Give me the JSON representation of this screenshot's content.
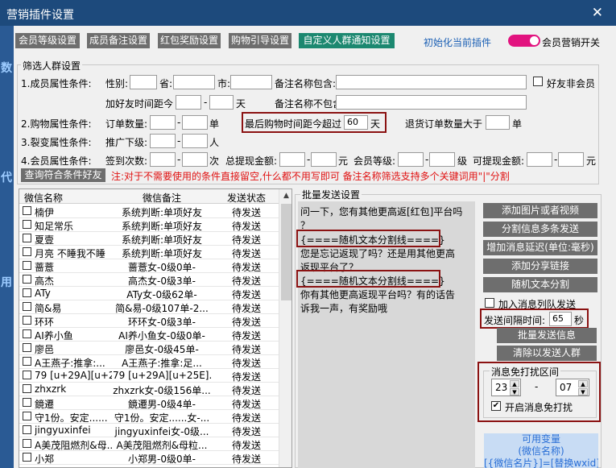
{
  "window": {
    "title": "营销插件设置"
  },
  "tabs": [
    {
      "label": "会员等级设置",
      "active": false
    },
    {
      "label": "成员备注设置",
      "active": false
    },
    {
      "label": "红包奖励设置",
      "active": false
    },
    {
      "label": "购物引导设置",
      "active": false
    },
    {
      "label": "自定义人群通知设置",
      "active": true
    }
  ],
  "header": {
    "init_link": "初始化当前插件",
    "toggle_label": "会员营销开关",
    "toggle_on": true
  },
  "filter": {
    "legend": "筛选人群设置",
    "row1": {
      "label": "1.成员属性条件:",
      "gender": "性别:",
      "province": "省:",
      "city": "市:",
      "remark_contains": "备注名称包含:",
      "friend_non_member": "好友非会员"
    },
    "row1b": {
      "add_days": "加好友时间距今",
      "dash": "-",
      "unit_day": "天",
      "remark_not_contains": "备注名称不包含:"
    },
    "row2": {
      "label": "2.购物属性条件:",
      "order_count": "订单数量:",
      "dash": "-",
      "unit": "单",
      "last_purchase": "最后购物时间距今超过",
      "last_purchase_value": "60",
      "last_purchase_unit": "天",
      "refund_orders": "退货订单数量大于",
      "refund_unit": "单"
    },
    "row3": {
      "label": "3.裂变属性条件:",
      "promote": "推广下级:",
      "dash": "-",
      "unit": "人"
    },
    "row4": {
      "label": "4.会员属性条件:",
      "checkins": "签到次数:",
      "dash": "-",
      "unit_times": "次",
      "total_withdraw": "总提现金额:",
      "unit_yuan": "元",
      "member_level": "会员等级:",
      "unit_level": "级",
      "available_withdraw": "可提现金额:",
      "unit_yuan2": "元"
    },
    "query_button": "查询符合条件好友",
    "note": "注:对于不需要使用的条件直接留空,什么都不用写即可 备注名称筛选支持多个关键词用\"|\"分割"
  },
  "table": {
    "headers": [
      "微信名称",
      "微信备注",
      "发送状态"
    ],
    "rows": [
      {
        "name": "楠伊",
        "remark": "系统判断:单项好友",
        "status": "待发送"
      },
      {
        "name": "知足常乐",
        "remark": "系统判断:单项好友",
        "status": "待发送"
      },
      {
        "name": "夏壹",
        "remark": "系统判断:单项好友",
        "status": "待发送"
      },
      {
        "name": "月亮 不睡我不睡",
        "remark": "系统判断:单项好友",
        "status": "待发送"
      },
      {
        "name": "蔷薏",
        "remark": "蔷薏女-0级0单-",
        "status": "待发送"
      },
      {
        "name": "高杰",
        "remark": "高杰女-0级3单-",
        "status": "待发送"
      },
      {
        "name": "ATy",
        "remark": "ATy女-0级62单-",
        "status": "待发送"
      },
      {
        "name": "简&易",
        "remark": "简&易-0级107单-2...",
        "status": "待发送"
      },
      {
        "name": "环环",
        "remark": "环环女-0级3单-",
        "status": "待发送"
      },
      {
        "name": "AI养小鱼",
        "remark": "AI养小鱼女-0级0单-",
        "status": "待发送"
      },
      {
        "name": "廖邑",
        "remark": "廖邑女-0级45单-",
        "status": "待发送"
      },
      {
        "name": "A王燕子:推拿:...",
        "remark": "A王燕子:推拿:足...",
        "status": "待发送"
      },
      {
        "name": "79 [u+29A][u+25...",
        "remark": "79 [u+29A][u+25E]...",
        "status": "待发送"
      },
      {
        "name": "zhxzrk",
        "remark": "zhxzrk女-0级156单...",
        "status": "待发送"
      },
      {
        "name": "鏡遷",
        "remark": "鏡遷男-0级4单-",
        "status": "待发送"
      },
      {
        "name": "守1份。安定......",
        "remark": "守1份。安定......女-...",
        "status": "待发送"
      },
      {
        "name": "jingyuxinfei",
        "remark": "jingyuxinfei女-0级...",
        "status": "待发送"
      },
      {
        "name": "A美茂阻燃剂&母...",
        "remark": "A美茂阻燃剂&母粒...",
        "status": "待发送"
      },
      {
        "name": "小郑",
        "remark": "小郑男-0级0单-",
        "status": "待发送"
      }
    ]
  },
  "bulk": {
    "legend": "批量发送设置",
    "message_lines": [
      "问一下，您有其他更高返[红包]平台吗",
      "？",
      "{====随机文本分割线====}",
      "您是忘记返现了吗？还是用其他更高",
      "返现平台了？",
      "{====随机文本分割线====}",
      "你有其他更高返现平台吗？有的话告",
      "诉我一声，有奖励哦"
    ],
    "buttons": [
      "添加图片或者视频",
      "分割信息多条发送",
      "增加消息延迟(单位:毫秒)",
      "添加分享链接",
      "随机文本分割"
    ],
    "queue_checkbox": "加入消息列队发送",
    "interval_label": "发送间隔时间:",
    "interval_value": "65",
    "interval_unit": "秒",
    "send_button": "批量发送信息",
    "clear_button": "清除以发送人群",
    "dnd": {
      "legend": "消息免打扰区间",
      "start": "23",
      "dash": "-",
      "end": "07",
      "enable_label": "开启消息免打扰",
      "enabled": true
    },
    "variables": {
      "title": "可用变量",
      "var1": "(微信名称)",
      "var2": "[{微信名片}]=[替换wxid]"
    }
  }
}
